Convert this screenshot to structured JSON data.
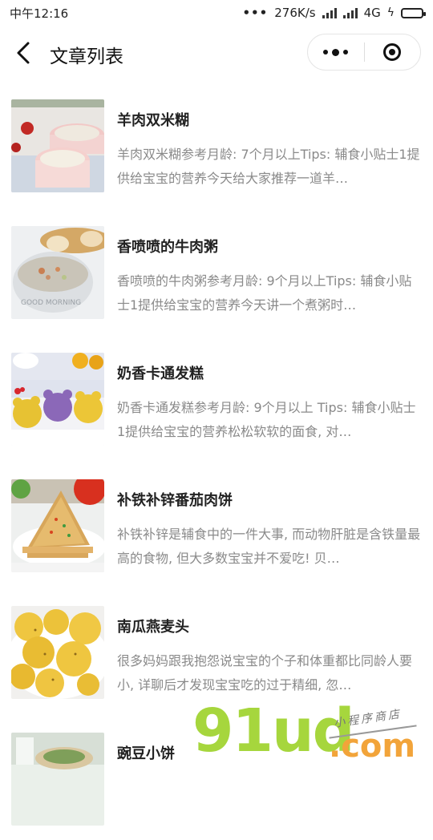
{
  "status_bar": {
    "time": "中午12:16",
    "dots": "•••",
    "speed": "276K/s",
    "network": "4G",
    "bolt": "ϟ"
  },
  "nav": {
    "title": "文章列表",
    "back_icon": "chevron-left-icon",
    "more_icon": "more-dots-icon",
    "close_icon": "target-circle-icon"
  },
  "articles": [
    {
      "title": "羊肉双米糊",
      "desc": "羊肉双米糊参考月龄: 7个月以上Tips: 辅食小贴士1提供给宝宝的营养今天给大家推荐一道羊…",
      "thumb": "porridge-bowls"
    },
    {
      "title": "香喷喷的牛肉粥",
      "desc": "香喷喷的牛肉粥参考月龄: 9个月以上Tips: 辅食小贴士1提供给宝宝的营养今天讲一个煮粥时…",
      "thumb": "beef-congee"
    },
    {
      "title": "奶香卡通发糕",
      "desc": "奶香卡通发糕参考月龄: 9个月以上 Tips: 辅食小贴士1提供给宝宝的营养松松软软的面食, 对…",
      "thumb": "cartoon-cakes"
    },
    {
      "title": "补铁补锌番茄肉饼",
      "desc": "补铁补锌是辅食中的一件大事, 而动物肝脏是含铁量最高的食物, 但大多数宝宝并不爱吃! 贝…",
      "thumb": "tomato-pancake"
    },
    {
      "title": "南瓜燕麦头",
      "desc": "很多妈妈跟我抱怨说宝宝的个子和体重都比同龄人要小, 详聊后才发现宝宝吃的过于精细, 忽…",
      "thumb": "pumpkin-buns"
    },
    {
      "title": "豌豆小饼",
      "desc": "",
      "thumb": "pea-cakes"
    }
  ],
  "watermark": {
    "main": "91ud",
    "dotcom": ".com",
    "sub": "小程序商店"
  },
  "colors": {
    "title": "#222222",
    "desc": "#8a8a8a",
    "watermark_green": "#a6d63d",
    "watermark_orange": "#f2a43a",
    "battery": "#3cc051"
  }
}
